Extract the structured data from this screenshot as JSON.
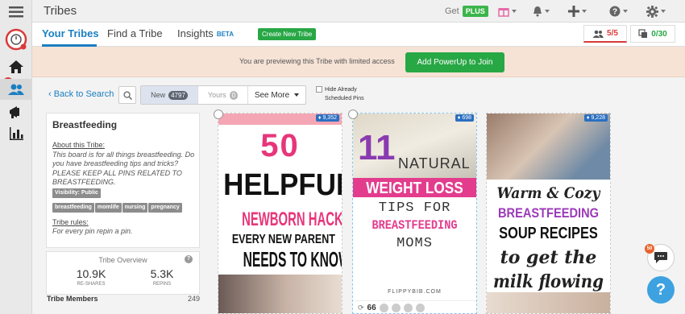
{
  "header": {
    "title": "Tribes",
    "get_label": "Get",
    "plus_label": "PLUS"
  },
  "tabs": {
    "your_tribes": "Your Tribes",
    "find": "Find a Tribe",
    "insights": "Insights",
    "beta": "BETA",
    "create_button": "Create New Tribe"
  },
  "counters": {
    "tribes": "5/5",
    "pins": "0/30",
    "tribes_color": "#d93a3a",
    "pins_color": "#28a745"
  },
  "banner": {
    "text": "You are previewing this Tribe with limited access",
    "button": "Add PowerUp to Join"
  },
  "filters": {
    "back": "‹ Back to Search",
    "new_label": "New",
    "new_count": "4797",
    "yours_label": "Yours",
    "yours_count": "0",
    "see_more": "See More",
    "hide_line1": "Hide Already",
    "hide_line2": "Scheduled Pins"
  },
  "board": {
    "title": "Breastfeeding",
    "about_label": "About this Tribe:",
    "about_text": "This board is for all things breastfeeding. Do you have breastfeeding tips and tricks? PLEASE KEEP ALL PINS RELATED TO BREASTFEEDING.",
    "visibility": "Visibility: Public",
    "tags": [
      "breastfeeding",
      "momlife",
      "nursing",
      "pregnancy"
    ],
    "rules_label": "Tribe rules:",
    "rules_text": "For every pin repin a pin."
  },
  "overview": {
    "title": "Tribe Overview",
    "reshares_value": "10.9K",
    "reshares_label": "RE-SHARES",
    "repins_value": "5.3K",
    "repins_label": "REPINS",
    "members_label": "Tribe Members",
    "members_count": "249"
  },
  "pins": [
    {
      "saves": "9,352",
      "line1": "50",
      "line2": "HELPFUL",
      "line3": "NEWBORN HACKS",
      "line4": "EVERY NEW PARENT",
      "line5": "NEEDS TO KNOW"
    },
    {
      "saves": "698",
      "line1": "11",
      "line2": "NATURAL",
      "line3": "WEIGHT LOSS",
      "line4": "TIPS FOR",
      "line5": "BREASTFEEDING",
      "line6": "MOMS",
      "site": "FLIPPYBIB.COM",
      "repins": "66"
    },
    {
      "saves": "9,228",
      "line1": "Warm & Cozy",
      "line2": "BREASTFEEDING",
      "line3": "SOUP RECIPES",
      "line4": "to get the",
      "line5": "milk flowing"
    }
  ],
  "chat_badge": "50",
  "help_label": "?",
  "icons": [
    "menu-icon",
    "logo-icon",
    "home-icon",
    "users-icon",
    "megaphone-icon",
    "bar-chart-icon",
    "gift-icon",
    "bell-icon",
    "plus-icon",
    "help-circle-icon",
    "gear-icon",
    "search-icon",
    "chat-icon",
    "flame-icon",
    "refresh-icon"
  ],
  "colors": {
    "accent": "#1a7fc1",
    "green": "#28a745",
    "banner": "#f6e3d6",
    "pink_title": "#ff3d7f",
    "purple": "#9b3ab8"
  }
}
